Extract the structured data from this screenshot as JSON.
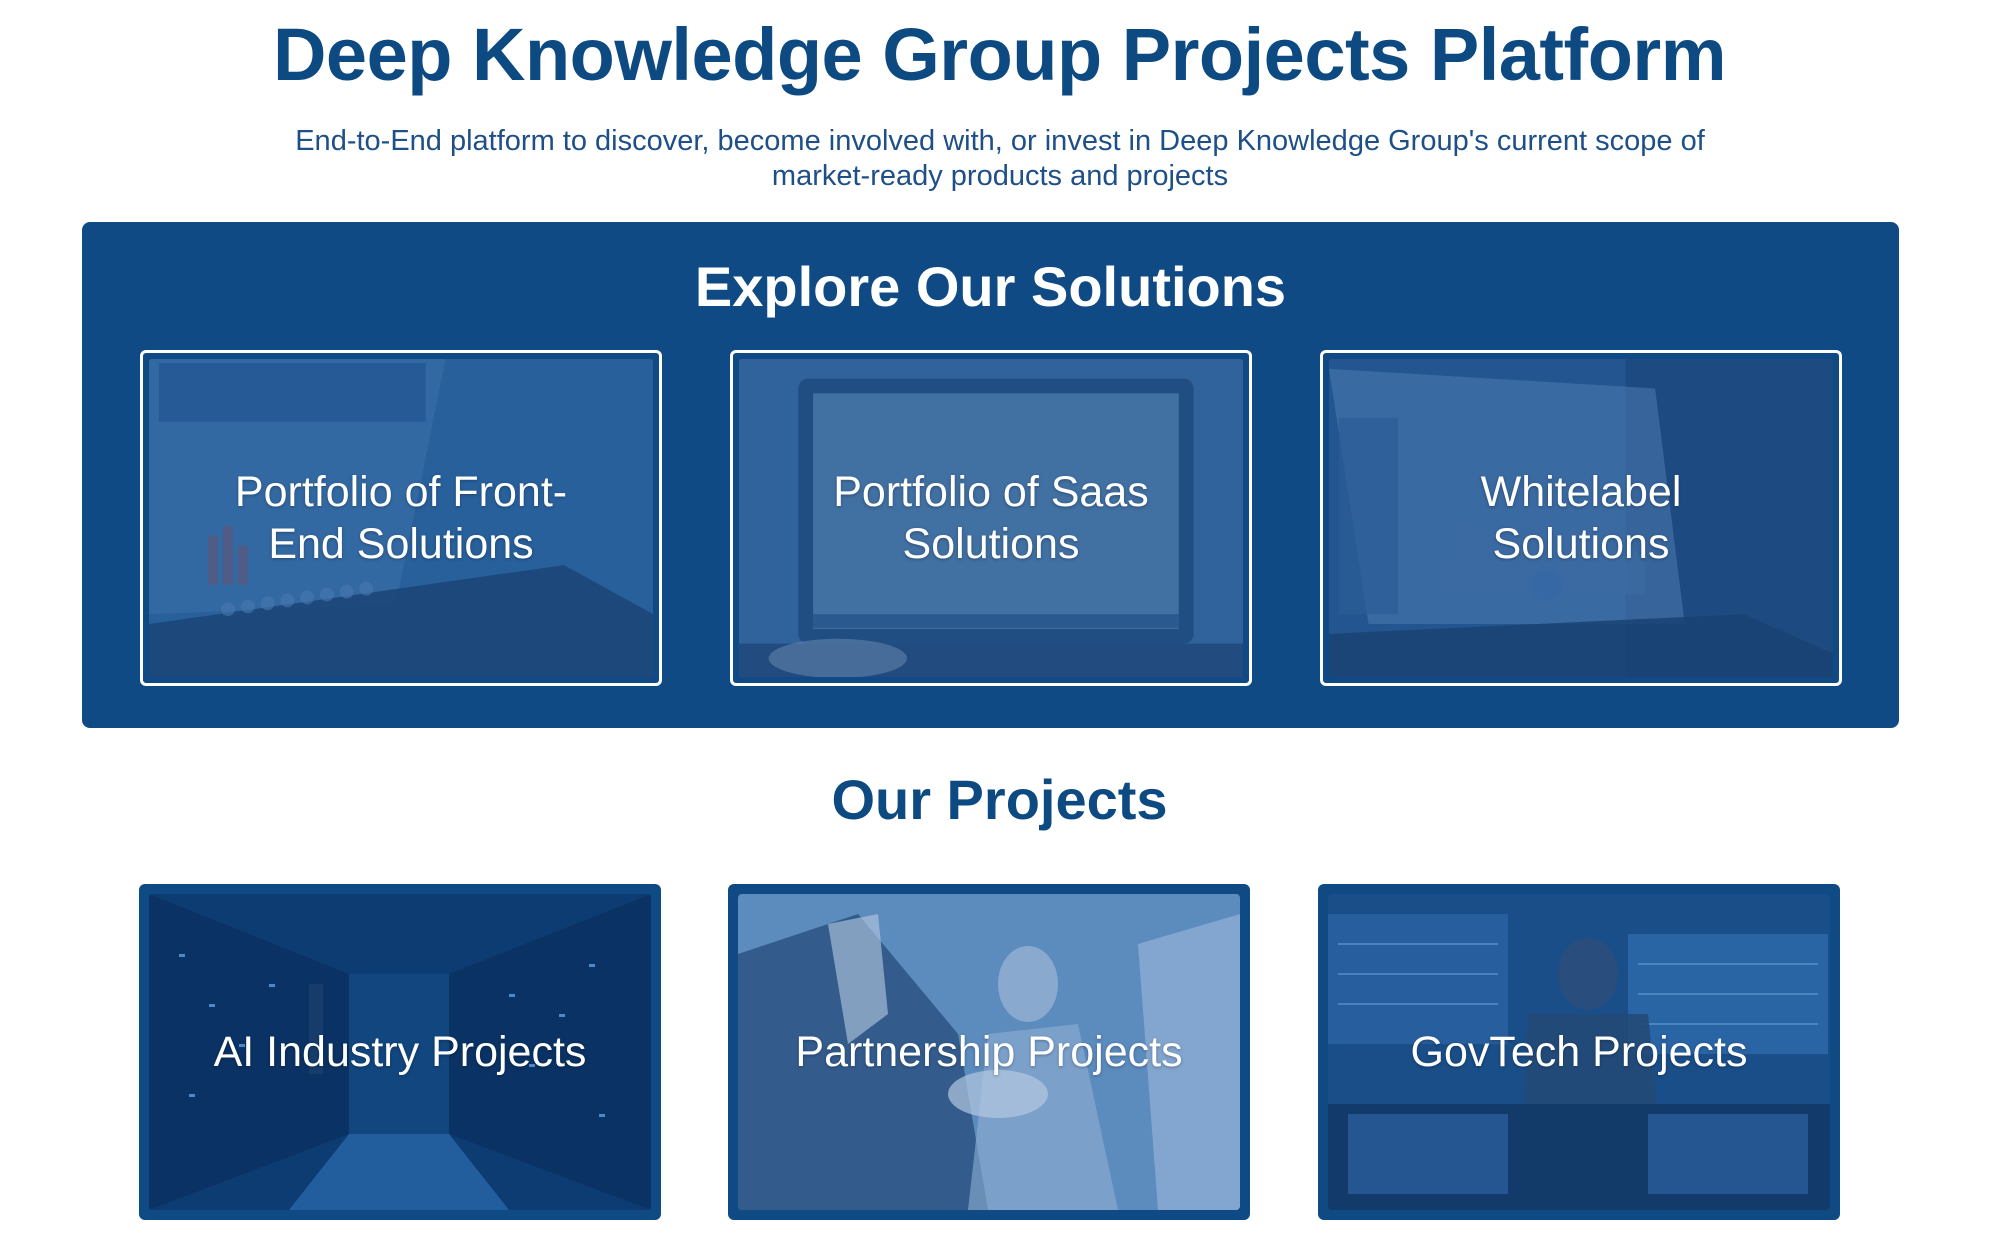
{
  "header": {
    "title": "Deep Knowledge Group Projects Platform",
    "subtitle": "End-to-End platform to discover, become involved with, or invest in Deep Knowledge Group's current scope of market-ready products and projects"
  },
  "solutions": {
    "title": "Explore Our Solutions",
    "cards": [
      {
        "label": "Portfolio of Front-End Solutions"
      },
      {
        "label": "Portfolio of Saas Solutions"
      },
      {
        "label": "Whitelabel Solutions"
      }
    ]
  },
  "projects": {
    "title": "Our Projects",
    "cards": [
      {
        "label": "AI Industry Projects"
      },
      {
        "label": "Partnership Projects"
      },
      {
        "label": "GovTech Projects"
      }
    ]
  },
  "colors": {
    "brand": "#0f4a84",
    "title": "#0e4a82",
    "card_border": "#ffffff"
  }
}
